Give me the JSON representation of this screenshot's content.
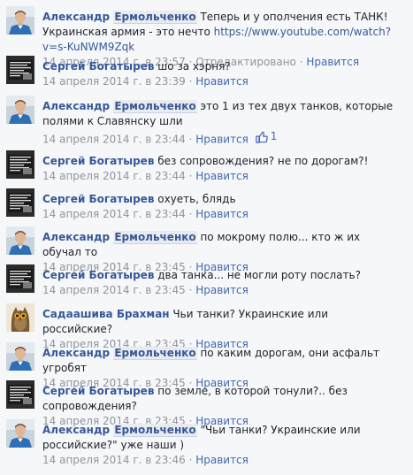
{
  "comments": [
    {
      "avatar": "man-blue-shirt",
      "author_first": "Александр",
      "author_last": "Ермольченко",
      "text": " Теперь и у ополчения есть ТАНК! Украинская армия - это нечто ",
      "link": "https://www.youtube.com/watch?v=s-KuNWM9Zqk",
      "date": "14 апреля 2014 г. в 23:57",
      "sep1": " · ",
      "edited": "Отредактировано",
      "sep2": " · ",
      "like": "Нравится"
    },
    {
      "avatar": "quote-image",
      "author": "Сергей Богатырев",
      "text": " шо за хэрня?",
      "date": "14 апреля 2014 г. в 23:39",
      "sep": " · ",
      "like": "Нравится"
    },
    {
      "avatar": "man-blue-shirt",
      "author_first": "Александр",
      "author_last": "Ермольченко",
      "text": " это 1 из тех двух танков, которые полями к Славянску шли",
      "date": "14 апреля 2014 г. в 23:44",
      "sep": " · ",
      "like": "Нравится",
      "like_count": "1"
    },
    {
      "avatar": "quote-image",
      "author": "Сергей Богатырев",
      "text": " без сопровождения? не по дорогам?!",
      "date": "14 апреля 2014 г. в 23:44",
      "sep": " · ",
      "like": "Нравится"
    },
    {
      "avatar": "quote-image",
      "author": "Сергей Богатырев",
      "text": " охуеть, блядь",
      "date": "14 апреля 2014 г. в 23:44",
      "sep": " · ",
      "like": "Нравится"
    },
    {
      "avatar": "man-blue-shirt",
      "author_first": "Александр",
      "author_last": "Ермольченко",
      "text": " по мокрому полю... кто ж их обучал то",
      "date": "14 апреля 2014 г. в 23:45",
      "sep": " · ",
      "like": "Нравится"
    },
    {
      "avatar": "quote-image",
      "author": "Сергей Богатырев",
      "text": " два танка... не могли роту послать?",
      "date": "14 апреля 2014 г. в 23:45",
      "sep": " · ",
      "like": "Нравится"
    },
    {
      "avatar": "owl",
      "author": "Садаашива Брахман",
      "text": " Чьи танки? Украинские или российские?",
      "date": "14 апреля 2014 г. в 23:45",
      "sep": " · ",
      "like": "Нравится"
    },
    {
      "avatar": "man-blue-shirt",
      "author_first": "Александр",
      "author_last": "Ермольченко",
      "text": " по каким дорогам, они асфальт угробят",
      "date": "14 апреля 2014 г. в 23:45",
      "sep": " · ",
      "like": "Нравится"
    },
    {
      "avatar": "quote-image",
      "author": "Сергей Богатырев",
      "text": " по земле, в которой тонули?.. без сопровождения?",
      "date": "14 апреля 2014 г. в 23:45",
      "sep": " · ",
      "like": "Нравится"
    },
    {
      "avatar": "man-blue-shirt",
      "author_first": "Александр",
      "author_last": "Ермольченко",
      "text": " \"Чьи танки? Украинские или российские?\" уже наши )",
      "date": "14 апреля 2014 г. в 23:46",
      "sep": " · ",
      "like": "Нравится"
    }
  ],
  "colors": {
    "background": "#f6f7f9",
    "link": "#365899",
    "meta": "#90949c",
    "like": "#4267b2"
  }
}
